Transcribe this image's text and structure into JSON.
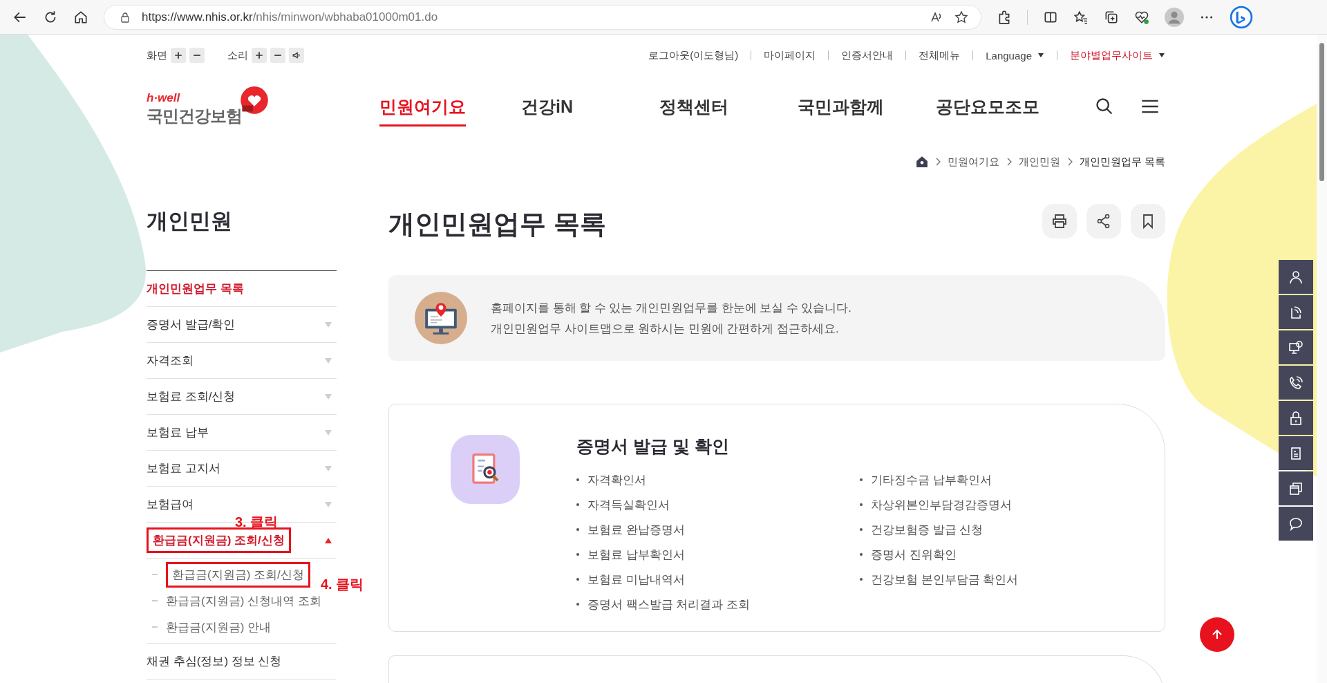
{
  "browser": {
    "url_host": "https://www.nhis.or.kr",
    "url_path": "/nhis/minwon/wbhaba01000m01.do"
  },
  "utility": {
    "screen_label": "화면",
    "sound_label": "소리",
    "links": [
      {
        "label": "로그아웃(이도형님)",
        "highlighted": false,
        "dropdown": false
      },
      {
        "label": "마이페이지",
        "highlighted": false,
        "dropdown": false
      },
      {
        "label": "인증서안내",
        "highlighted": false,
        "dropdown": false
      },
      {
        "label": "전체메뉴",
        "highlighted": false,
        "dropdown": false
      },
      {
        "label": "Language",
        "highlighted": false,
        "dropdown": true
      },
      {
        "label": "분야별업무사이트",
        "highlighted": true,
        "dropdown": true
      }
    ]
  },
  "logo": {
    "tagline": "h·well",
    "name": "국민건강보험"
  },
  "nav": [
    {
      "label": "민원여기요",
      "selected": true
    },
    {
      "label": "건강iN",
      "selected": false
    },
    {
      "label": "정책센터",
      "selected": false
    },
    {
      "label": "국민과함께",
      "selected": false
    },
    {
      "label": "공단요모조모",
      "selected": false
    }
  ],
  "breadcrumb": [
    "민원여기요",
    "개인민원",
    "개인민원업무 목록"
  ],
  "sidebar": {
    "title": "개인민원",
    "items": [
      {
        "label": "개인민원업무 목록",
        "selected": true,
        "kind": "link"
      },
      {
        "label": "증명서 발급/확인",
        "selected": false,
        "kind": "group",
        "expanded": false
      },
      {
        "label": "자격조회",
        "selected": false,
        "kind": "group",
        "expanded": false
      },
      {
        "label": "보험료 조회/신청",
        "selected": false,
        "kind": "group",
        "expanded": false
      },
      {
        "label": "보험료 납부",
        "selected": false,
        "kind": "group",
        "expanded": false
      },
      {
        "label": "보험료 고지서",
        "selected": false,
        "kind": "group",
        "expanded": false
      },
      {
        "label": "보험급여",
        "selected": false,
        "kind": "group",
        "expanded": false
      },
      {
        "label": "환급금(지원금) 조회/신청",
        "selected": true,
        "kind": "group",
        "expanded": true,
        "annotation": "3. 클릭",
        "children": [
          {
            "label": "환급금(지원금) 조회/신청",
            "selected": false,
            "annotation": "4. 클릭"
          },
          {
            "label": "환급금(지원금) 신청내역 조회",
            "selected": false
          },
          {
            "label": "환급금(지원금) 안내",
            "selected": false
          }
        ]
      },
      {
        "label": "채권 추심(정보) 정보 신청",
        "selected": false,
        "kind": "link"
      }
    ]
  },
  "page": {
    "title": "개인민원업무 목록",
    "info": [
      "홈페이지를 통해 할 수 있는 개인민원업무를 한눈에 보실 수 있습니다.",
      "개인민원업무 사이트맵으로 원하시는 민원에 간편하게 접근하세요."
    ],
    "card": {
      "title": "증명서 발급 및 확인",
      "columns": [
        [
          "자격확인서",
          "자격득실확인서",
          "보험료 완납증명서",
          "보험료 납부확인서",
          "보험료 미납내역서",
          "증명서 팩스발급 처리결과 조회"
        ],
        [
          "기타징수금 납부확인서",
          "차상위본인부담경감증명서",
          "건강보험증 발급 신청",
          "증명서 진위확인",
          "건강보험 본인부담금 확인서"
        ]
      ]
    }
  }
}
